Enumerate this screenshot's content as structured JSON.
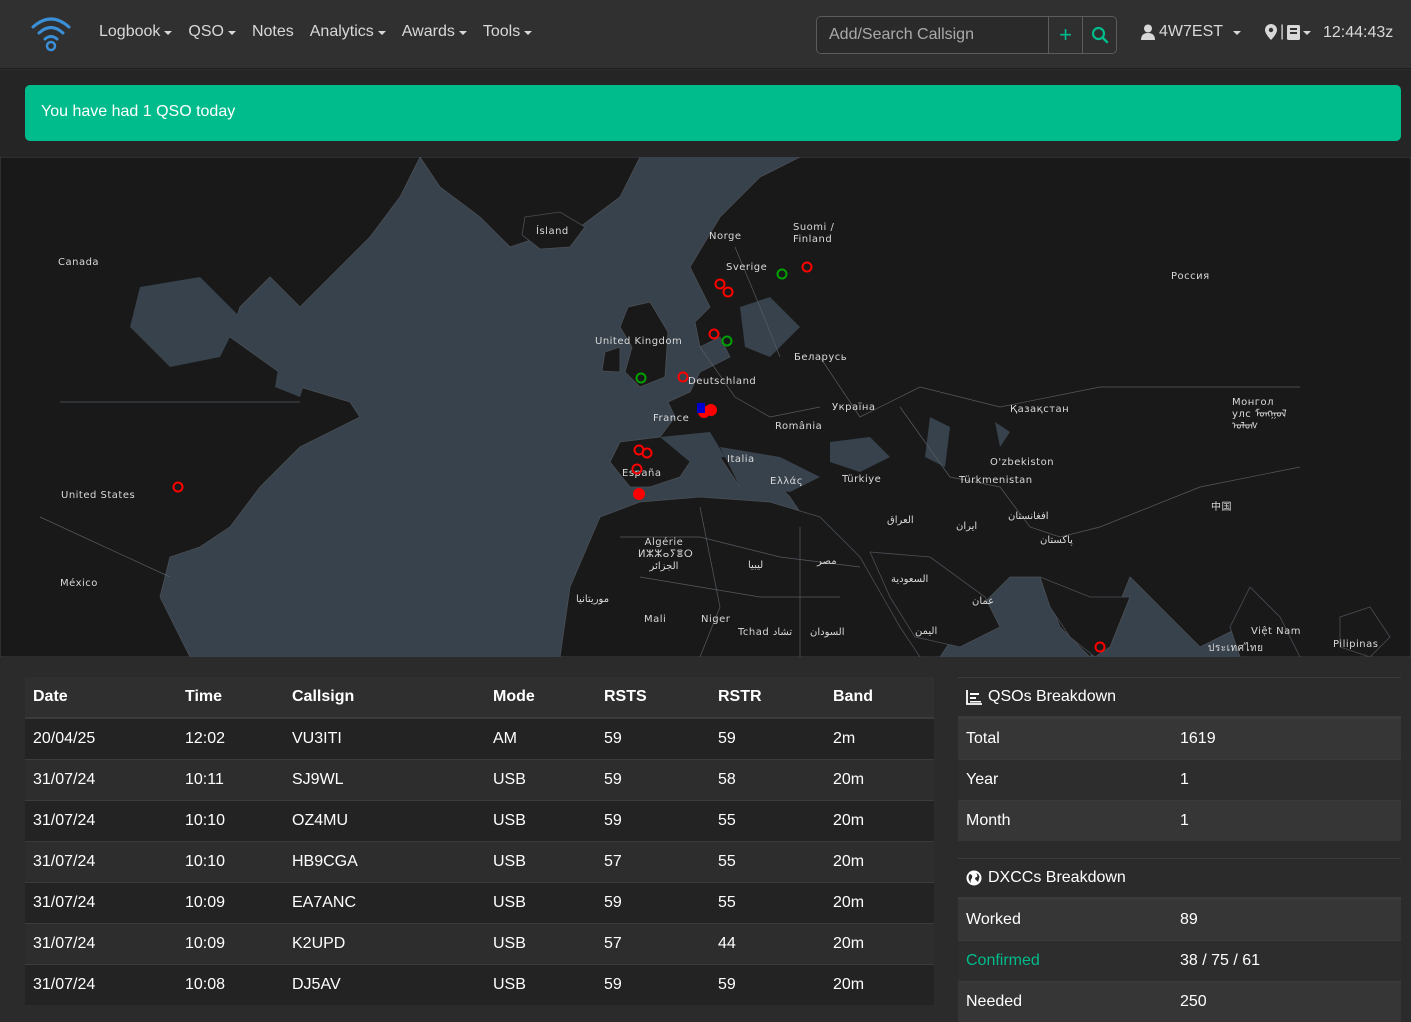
{
  "nav": {
    "menu": [
      {
        "label": "Logbook",
        "dropdown": true
      },
      {
        "label": "QSO",
        "dropdown": true
      },
      {
        "label": "Notes",
        "dropdown": false
      },
      {
        "label": "Analytics",
        "dropdown": true
      },
      {
        "label": "Awards",
        "dropdown": true
      },
      {
        "label": "Tools",
        "dropdown": true
      }
    ],
    "search_placeholder": "Add/Search Callsign",
    "user": "4W7EST",
    "clock": "12:44:43z"
  },
  "alert": "You have had 1 QSO today",
  "map": {
    "labels": [
      "Canada",
      "Ísland",
      "Norge",
      "Suomi / Finland",
      "Sverige",
      "Россия",
      "United Kingdom",
      "Беларусь",
      "Deutschland",
      "France",
      "Україна",
      "România",
      "Қазақстан",
      "Монгол улс ᠮᠣᠩᠭᠣᠯ ᠤᠯᠤᠰ",
      "United States",
      "España",
      "Italia",
      "O'zbekiston",
      "Türkmenistan",
      "Ελλάς",
      "Türkiye",
      "México",
      "Algérie ⵍⵣⵣⴰⵢⴻⵔ الجزائر",
      "العراق",
      "ایران",
      "افغانستان",
      "پاکستان",
      "中国",
      "ليبيا",
      "مصر",
      "السعودية",
      "موريتانيا",
      "Mali",
      "Niger",
      "Tchad تشاد",
      "السودان",
      "عمان",
      "اليمن",
      "Việt Nam",
      "ประเทศไทย",
      "Pilipinas"
    ]
  },
  "table": {
    "headers": [
      "Date",
      "Time",
      "Callsign",
      "Mode",
      "RSTS",
      "RSTR",
      "Band"
    ],
    "rows": [
      [
        "20/04/25",
        "12:02",
        "VU3ITI",
        "AM",
        "59",
        "59",
        "2m"
      ],
      [
        "31/07/24",
        "10:11",
        "SJ9WL",
        "USB",
        "59",
        "58",
        "20m"
      ],
      [
        "31/07/24",
        "10:10",
        "OZ4MU",
        "USB",
        "59",
        "55",
        "20m"
      ],
      [
        "31/07/24",
        "10:10",
        "HB9CGA",
        "USB",
        "57",
        "55",
        "20m"
      ],
      [
        "31/07/24",
        "10:09",
        "EA7ANC",
        "USB",
        "59",
        "55",
        "20m"
      ],
      [
        "31/07/24",
        "10:09",
        "K2UPD",
        "USB",
        "57",
        "44",
        "20m"
      ],
      [
        "31/07/24",
        "10:08",
        "DJ5AV",
        "USB",
        "59",
        "59",
        "20m"
      ]
    ]
  },
  "qso_breakdown": {
    "title": "QSOs Breakdown",
    "rows": [
      [
        "Total",
        "1619"
      ],
      [
        "Year",
        "1"
      ],
      [
        "Month",
        "1"
      ]
    ]
  },
  "dxcc_breakdown": {
    "title": "DXCCs Breakdown",
    "rows": [
      [
        "Worked",
        "89"
      ],
      [
        "Confirmed",
        "38 / 75 / 61"
      ],
      [
        "Needed",
        "250"
      ]
    ]
  },
  "colors": {
    "accent": "#00bc8c",
    "marker_unconfirmed": "#ff0000",
    "marker_confirmed": "#00a000"
  }
}
